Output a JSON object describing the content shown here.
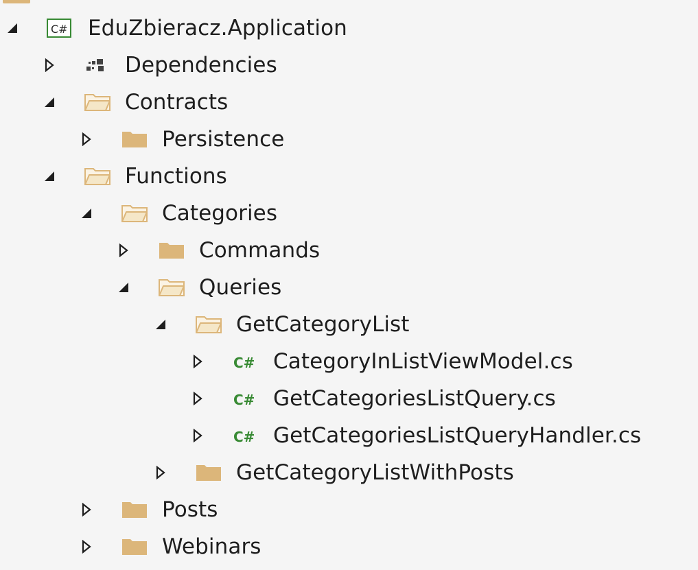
{
  "colors": {
    "background": "#f5f5f5",
    "text": "#1e1e1e",
    "folder": "#dcb67a",
    "folder_open_outline": "#c9a461",
    "csharp_green": "#388a34",
    "expander": "#1e1e1e"
  },
  "tree": {
    "rows": [
      {
        "label": "EduZbieracz.Application",
        "icon": "csharp-project-icon",
        "state": "expanded",
        "depth": 0
      },
      {
        "label": "Dependencies",
        "icon": "dependencies-icon",
        "state": "collapsed",
        "depth": 1
      },
      {
        "label": "Contracts",
        "icon": "folder-open-icon",
        "state": "expanded",
        "depth": 1
      },
      {
        "label": "Persistence",
        "icon": "folder-icon",
        "state": "collapsed",
        "depth": 2
      },
      {
        "label": "Functions",
        "icon": "folder-open-icon",
        "state": "expanded",
        "depth": 1
      },
      {
        "label": "Categories",
        "icon": "folder-open-icon",
        "state": "expanded",
        "depth": 2
      },
      {
        "label": "Commands",
        "icon": "folder-icon",
        "state": "collapsed",
        "depth": 3
      },
      {
        "label": "Queries",
        "icon": "folder-open-icon",
        "state": "expanded",
        "depth": 3
      },
      {
        "label": "GetCategoryList",
        "icon": "folder-open-icon",
        "state": "expanded",
        "depth": 4
      },
      {
        "label": "CategoryInListViewModel.cs",
        "icon": "csharp-file-icon",
        "state": "collapsed",
        "depth": 5
      },
      {
        "label": "GetCategoriesListQuery.cs",
        "icon": "csharp-file-icon",
        "state": "collapsed",
        "depth": 5
      },
      {
        "label": "GetCategoriesListQueryHandler.cs",
        "icon": "csharp-file-icon",
        "state": "collapsed",
        "depth": 5
      },
      {
        "label": "GetCategoryListWithPosts",
        "icon": "folder-icon",
        "state": "collapsed",
        "depth": 4
      },
      {
        "label": "Posts",
        "icon": "folder-icon",
        "state": "collapsed",
        "depth": 2
      },
      {
        "label": "Webinars",
        "icon": "folder-icon",
        "state": "collapsed",
        "depth": 2
      }
    ],
    "csharp_glyph": "C#"
  }
}
